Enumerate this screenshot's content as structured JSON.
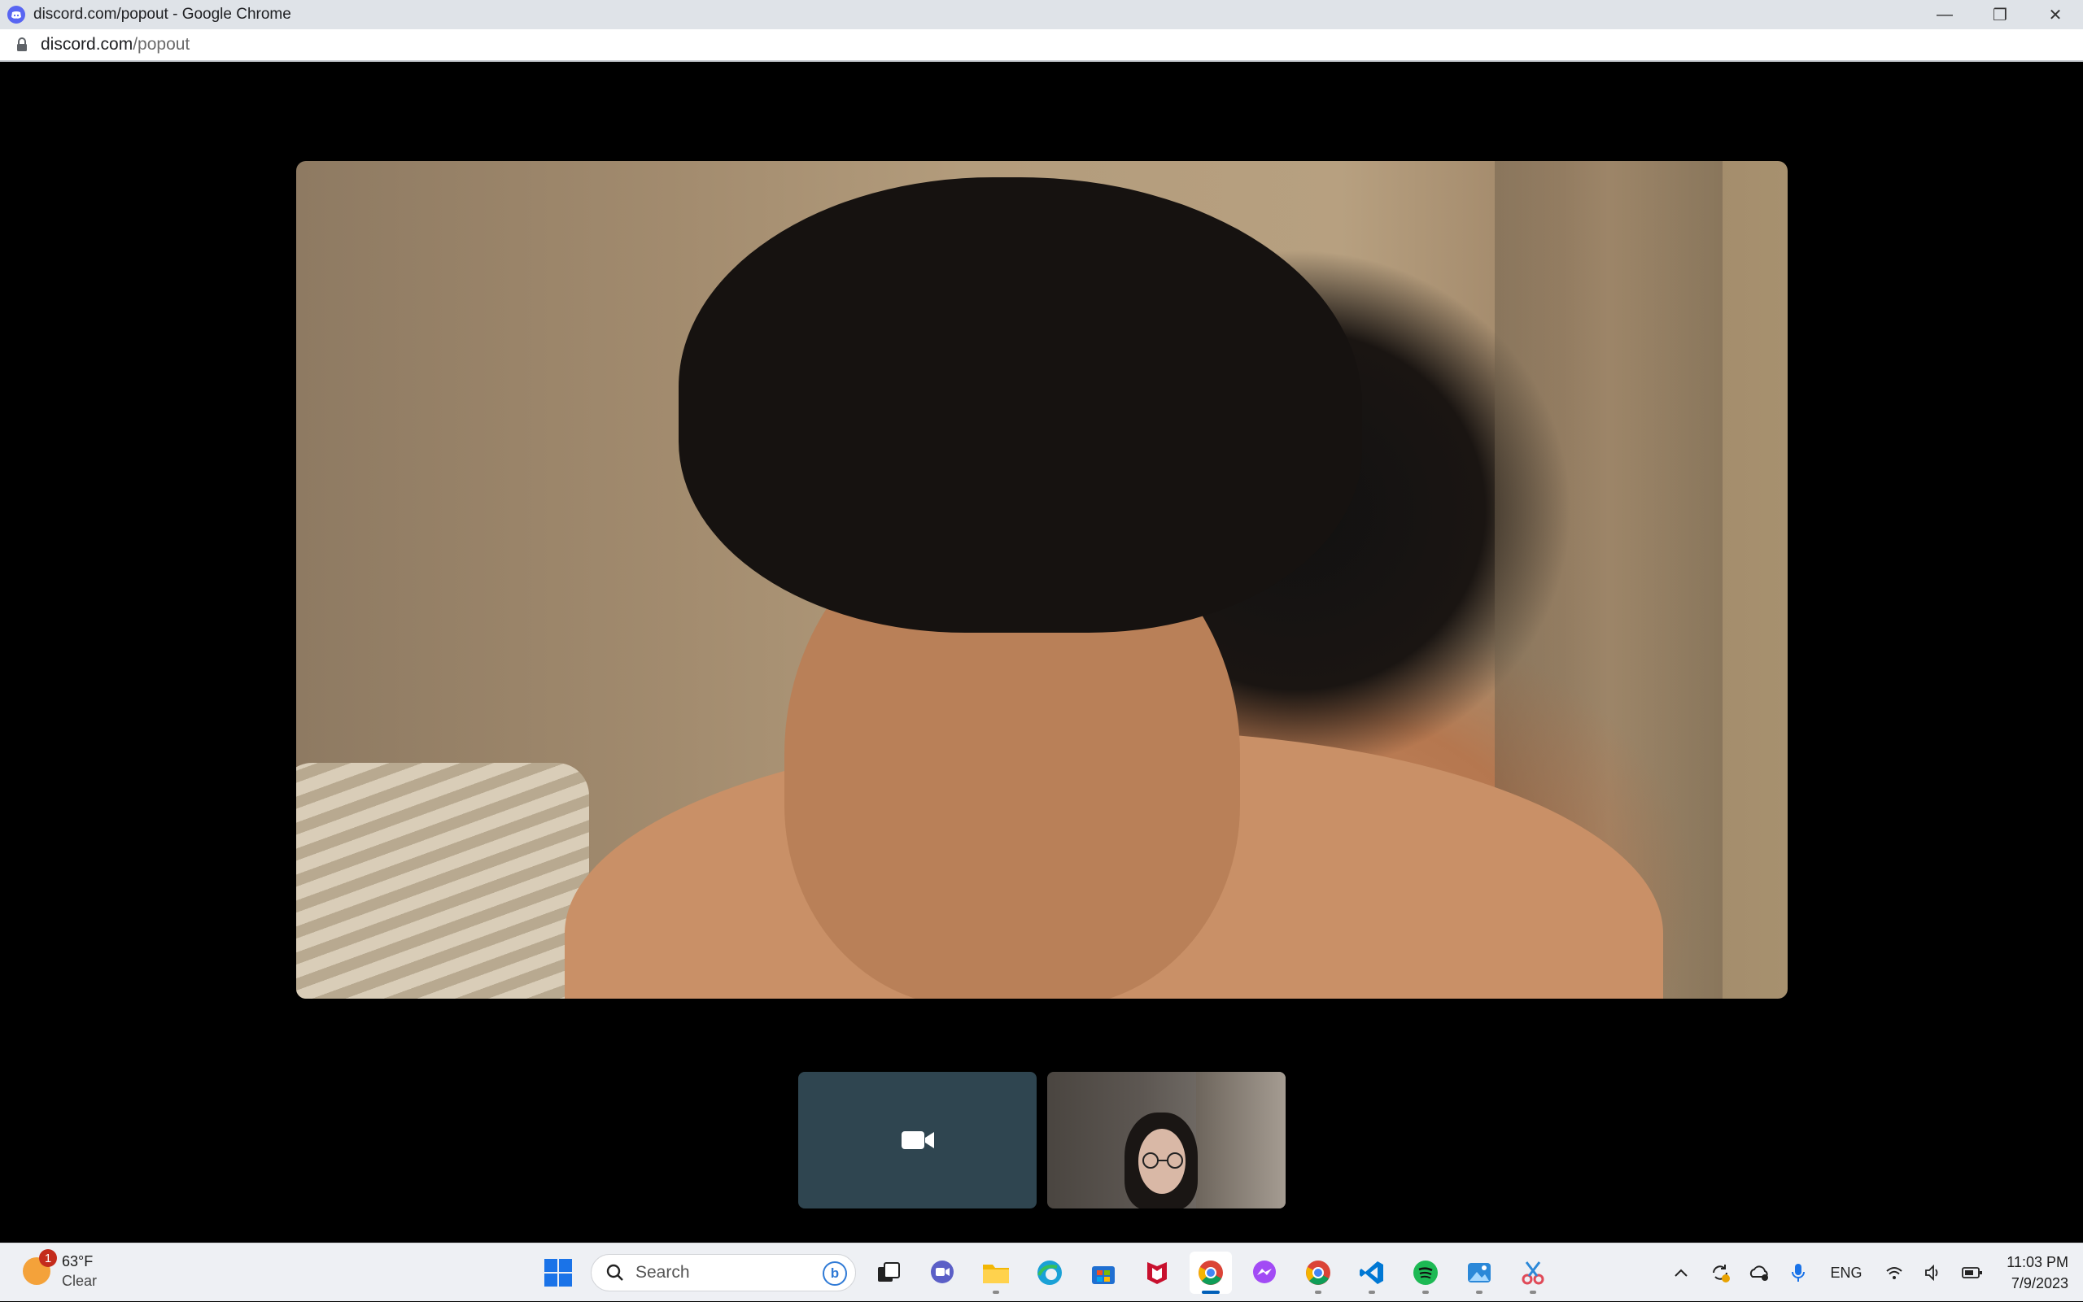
{
  "window": {
    "title": "discord.com/popout - Google Chrome",
    "controls": {
      "minimize": "—",
      "restore": "❐",
      "close": "✕"
    }
  },
  "address": {
    "domain": "discord.com",
    "path": "/popout"
  },
  "call": {
    "main_video": "camera-feed",
    "camera_tile_icon": "video-camera-icon",
    "user_tile": "participant-video"
  },
  "taskbar": {
    "weather": {
      "badge": "1",
      "temperature": "63°F",
      "condition": "Clear"
    },
    "search_label": "Search",
    "pinned": [
      "start-icon",
      "search",
      "task-view-icon",
      "chat-icon",
      "file-explorer-icon",
      "edge-icon",
      "microsoft-store-icon",
      "mcafee-icon",
      "chrome-icon",
      "messenger-icon",
      "chrome-profile-icon",
      "vscode-icon",
      "spotify-icon",
      "photos-icon",
      "snipping-tool-icon"
    ],
    "tray": {
      "language": "ENG",
      "time": "11:03 PM",
      "date": "7/9/2023"
    }
  }
}
